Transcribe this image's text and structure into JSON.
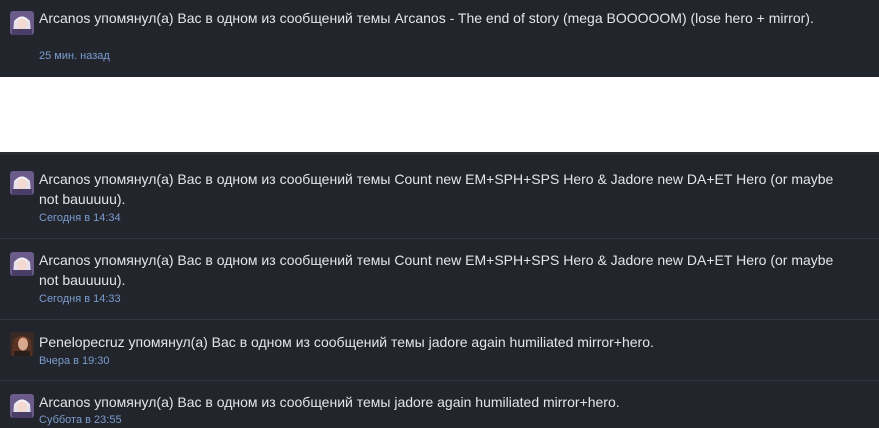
{
  "alerts": [
    {
      "user": "Arcanos",
      "action": " упомянул(а) Вас в одном из сообщений темы ",
      "thread": "Arcanos - The end of story (mega BOOOOOM) (lose hero + mirror)",
      "suffix": ".",
      "time": "25 мин. назад",
      "avatar": "anime-avatar-white-hair"
    },
    {
      "user": "Arcanos",
      "action": " упомянул(а) Вас в одном из сообщений темы ",
      "thread": "Count new EM+SPH+SPS Hero & Jadore new DA+ET Hero (or maybe not bauuuuu)",
      "suffix": ".",
      "time": "Сегодня в 14:34",
      "avatar": "anime-avatar-white-hair"
    },
    {
      "user": "Arcanos",
      "action": " упомянул(а) Вас в одном из сообщений темы ",
      "thread": "Count new EM+SPH+SPS Hero & Jadore new DA+ET Hero (or maybe not bauuuuu)",
      "suffix": ".",
      "time": "Сегодня в 14:33",
      "avatar": "anime-avatar-white-hair"
    },
    {
      "user": "Penelopecruz",
      "action": " упомянул(а) Вас в одном из сообщений темы ",
      "thread": "jadore again humiliated mirror+hero",
      "suffix": ".",
      "time": "Вчера в 19:30",
      "avatar": "photo-avatar-brown-hair"
    },
    {
      "user": "Arcanos",
      "action": " упомянул(а) Вас в одном из сообщений темы ",
      "thread": "jadore again humiliated mirror+hero",
      "suffix": ".",
      "time": "Суббота в 23:55",
      "avatar": "anime-avatar-white-hair"
    }
  ],
  "colors": {
    "background": "#23252d",
    "text": "#e4e5e7",
    "time": "#7a9ccd",
    "divider": "#34363f"
  }
}
